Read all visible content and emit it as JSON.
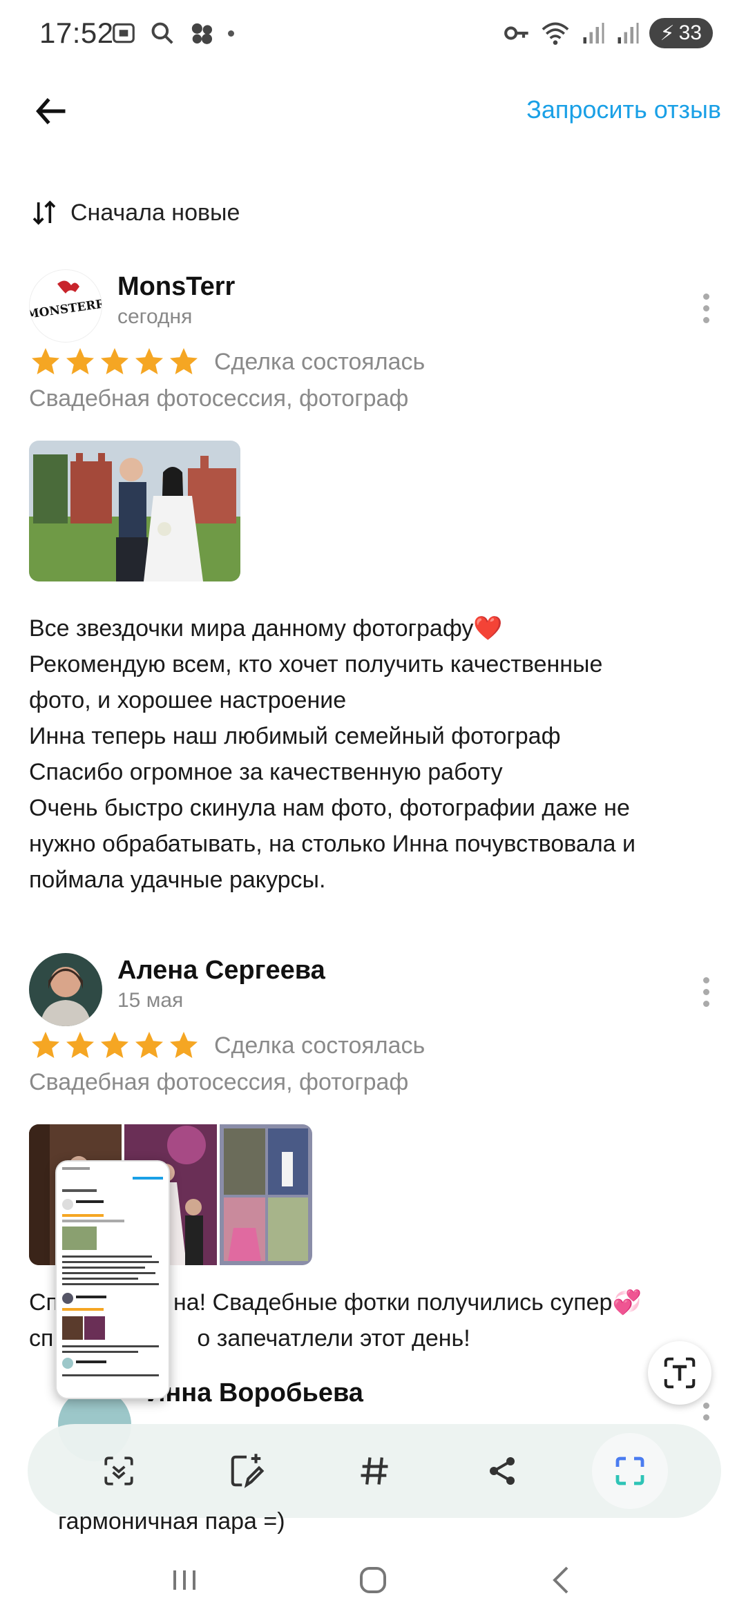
{
  "status_bar": {
    "time": "17:52",
    "battery": "33"
  },
  "header": {
    "request_review": "Запросить отзыв"
  },
  "sort": {
    "label": "Сначала новые"
  },
  "reviews": [
    {
      "name": "MonsTerr",
      "avatar_text": "MONSTERR",
      "date": "сегодня",
      "rating": 5,
      "deal_status": "Сделка состоялась",
      "service": "Свадебная фотосессия, фотограф",
      "text_lines": [
        "Все звездочки мира данному фотографу❤️",
        "Рекомендую всем, кто хочет получить качественные",
        "фото, и хорошее настроение",
        "Инна теперь наш любимый семейный фотограф",
        "Спасибо огромное за качественную работу",
        "Очень быстро скинула нам фото, фотографии даже не",
        "нужно обрабатывать, на столько Инна почувствовала и",
        "поймала удачные ракурсы."
      ]
    },
    {
      "name": "Алена Сергеева",
      "date": "15 мая",
      "rating": 5,
      "deal_status": "Сделка состоялась",
      "service": "Свадебная фотосессия, фотограф",
      "text_lines_visible": [
        "Сп",
        "на! Свадебные фотки получились супер💞",
        "сп",
        "о запечатлели этот день!"
      ]
    },
    {
      "name": "Инна Воробьева",
      "partial_text": "гармоничная пара =)"
    }
  ],
  "toolbar": {
    "items": [
      "scan-icon",
      "edit-icon",
      "hashtag-icon",
      "share-icon",
      "crop-icon"
    ]
  },
  "colors": {
    "accent": "#1aa0e6",
    "star": "#f5a623",
    "muted": "#8a8a8a"
  }
}
